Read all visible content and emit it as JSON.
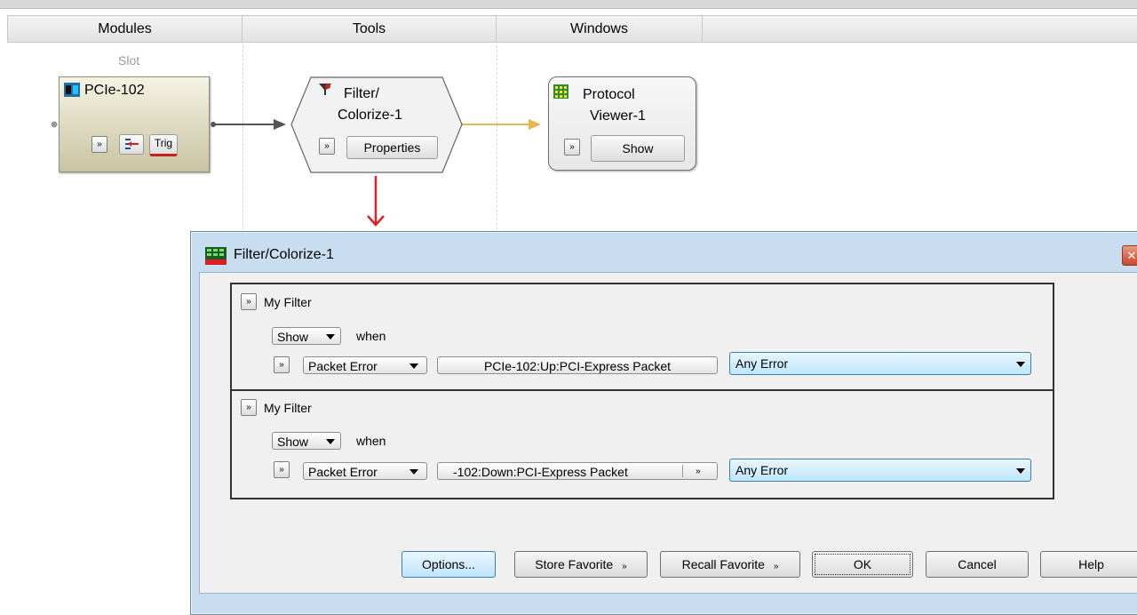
{
  "header": {
    "columns": [
      "Modules",
      "Tools",
      "Windows"
    ]
  },
  "canvas": {
    "slot_label": "Slot",
    "module": {
      "title": "PCIe-102",
      "trig_label": "Trig"
    },
    "tool": {
      "title_line1": "Filter/",
      "title_line2": "Colorize-1",
      "properties_label": "Properties"
    },
    "window": {
      "title_line1": "Protocol",
      "title_line2": "Viewer-1",
      "show_label": "Show"
    },
    "colors": {
      "link_gray": "#555555",
      "link_orange": "#e8b64c",
      "arrow_red": "#e02020"
    }
  },
  "dialog": {
    "title": "Filter/Colorize-1",
    "filters": [
      {
        "name": "My Filter",
        "action": "Show",
        "when_label": "when",
        "condition": "Packet Error",
        "source": "PCIe-102:Up:PCI-Express Packet",
        "value": "Any Error"
      },
      {
        "name": "My Filter",
        "action": "Show",
        "when_label": "when",
        "condition": "Packet Error",
        "source": "-102:Down:PCI-Express Packet",
        "value": "Any Error"
      }
    ],
    "buttons": {
      "options": "Options...",
      "store_favorite": "Store Favorite",
      "recall_favorite": "Recall Favorite",
      "ok": "OK",
      "cancel": "Cancel",
      "help": "Help"
    },
    "close_glyph": "✕"
  }
}
